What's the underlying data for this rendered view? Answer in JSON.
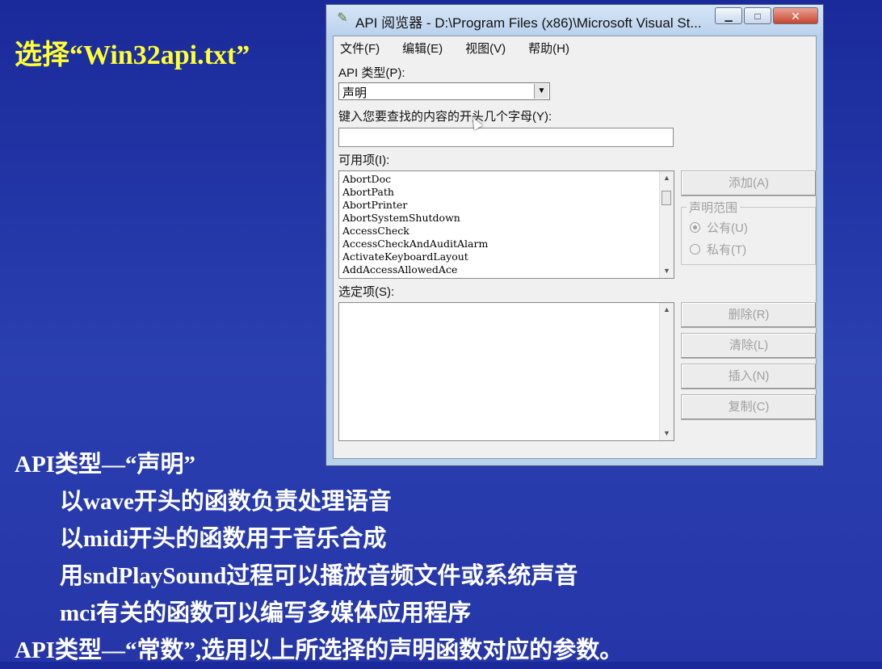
{
  "slide": {
    "title": "选择“Win32api.txt”",
    "bullets": [
      {
        "text": "API类型—“声明”",
        "indent": false
      },
      {
        "text": "以wave开头的函数负责处理语音",
        "indent": true
      },
      {
        "text": "以midi开头的函数用于音乐合成",
        "indent": true
      },
      {
        "text": "用sndPlaySound过程可以播放音频文件或系统声音",
        "indent": true
      },
      {
        "text": "mci有关的函数可以编写多媒体应用程序",
        "indent": true
      },
      {
        "text": "API类型—“常数”,选用以上所选择的声明函数对应的参数。",
        "indent": false
      }
    ]
  },
  "window": {
    "title": "API 阅览器 - D:\\Program Files (x86)\\Microsoft Visual St...",
    "icon": "api-viewer-icon",
    "menu": [
      "文件(F)",
      "编辑(E)",
      "视图(V)",
      "帮助(H)"
    ],
    "api_type_label": "API 类型(P):",
    "api_type_value": "声明",
    "search_label": "键入您要查找的内容的开头几个字母(Y):",
    "search_value": "",
    "available_label": "可用项(I):",
    "available_items": [
      "AbortDoc",
      "AbortPath",
      "AbortPrinter",
      "AbortSystemShutdown",
      "AccessCheck",
      "AccessCheckAndAuditAlarm",
      "ActivateKeyboardLayout",
      "AddAccessAllowedAce"
    ],
    "selected_label": "选定项(S):",
    "add_button": "添加(A)",
    "scope_group": "声明范围",
    "scope_public": "公有(U)",
    "scope_private": "私有(T)",
    "scope_selected": "public",
    "remove_button": "删除(R)",
    "clear_button": "清除(L)",
    "insert_button": "插入(N)",
    "copy_button": "复制(C)"
  }
}
